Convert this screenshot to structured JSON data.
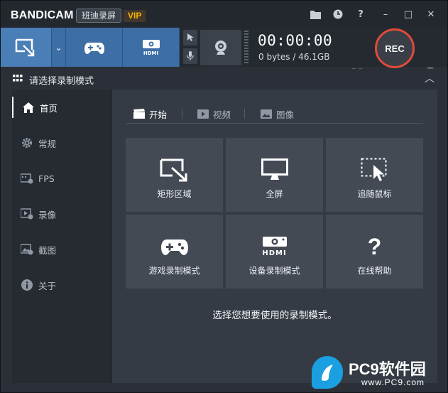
{
  "app": {
    "brand": "BANDICAM",
    "brand_cn": "班迪录屏",
    "vip": "VIP"
  },
  "titlebar_icons": [
    "folder-icon",
    "clock-icon",
    "help-icon",
    "minimize-icon",
    "maximize-icon",
    "close-icon"
  ],
  "titlebar_glyphs": {
    "help": "?",
    "minimize": "–",
    "maximize": "□",
    "close": "✕"
  },
  "toolbar": {
    "timer": "00:00:00",
    "size": "0 bytes / 46.1GB",
    "rec_label": "REC",
    "dropdown_glyph": "⌄",
    "mode_hdmi": "HDMI",
    "accent_rec": "#e04a3a"
  },
  "section": {
    "title": "请选择录制模式",
    "collapse_glyph": "︿"
  },
  "sidebar": {
    "items": [
      {
        "label": "首页",
        "icon": "home-icon",
        "active": true
      },
      {
        "label": "常规",
        "icon": "gear-icon"
      },
      {
        "label": "FPS",
        "icon": "fps-icon"
      },
      {
        "label": "录像",
        "icon": "video-settings-icon"
      },
      {
        "label": "截图",
        "icon": "image-settings-icon"
      },
      {
        "label": "关于",
        "icon": "info-icon"
      }
    ]
  },
  "main": {
    "tabs": [
      {
        "label": "开始",
        "icon": "clapper-icon",
        "active": true
      },
      {
        "label": "视频",
        "icon": "video-icon"
      },
      {
        "label": "图像",
        "icon": "image-icon"
      }
    ],
    "tiles": [
      {
        "label": "矩形区域",
        "icon": "rectangle-area-icon"
      },
      {
        "label": "全屏",
        "icon": "monitor-icon"
      },
      {
        "label": "追随鼠标",
        "icon": "follow-mouse-icon"
      },
      {
        "label": "游戏录制模式",
        "icon": "gamepad-icon"
      },
      {
        "label": "设备录制模式",
        "icon": "hdmi-icon",
        "hdmi_text": "HDMI"
      },
      {
        "label": "在线帮助",
        "icon": "question-icon",
        "glyph": "?"
      }
    ],
    "hint": "选择您想要使用的录制模式。"
  },
  "watermark": {
    "text": "PC9软件园",
    "url": "www.PC9.com"
  }
}
